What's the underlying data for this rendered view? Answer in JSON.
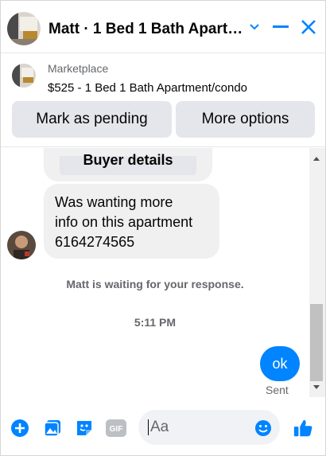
{
  "header": {
    "title": "Matt · 1 Bed 1 Bath Apartm...",
    "icons": [
      "chevron-down-icon",
      "minimize-icon",
      "close-icon"
    ]
  },
  "marketplace": {
    "label": "Marketplace",
    "listing": "$525 - 1 Bed 1 Bath Apartment/condo",
    "mark_pending": "Mark as pending",
    "more_options": "More options"
  },
  "conversation": {
    "buyer_details": "Buyer details",
    "messages": [
      {
        "from": "Matt",
        "lines": [
          "Was wanting more",
          "info on this apartment",
          "6164274565"
        ]
      }
    ],
    "status": "Matt is waiting for your response.",
    "time": "5:11 PM",
    "outgoing": {
      "text": "ok",
      "state": "Sent"
    }
  },
  "composer": {
    "placeholder": "Aa",
    "icons": [
      "add-icon",
      "photo-icon",
      "sticker-icon",
      "gif-icon",
      "emoji-icon",
      "like-icon"
    ]
  },
  "colors": {
    "accent": "#0084ff",
    "bubble_gray": "#f0f0f0",
    "button_gray": "#e4e6eb",
    "muted_text": "#65676b"
  }
}
